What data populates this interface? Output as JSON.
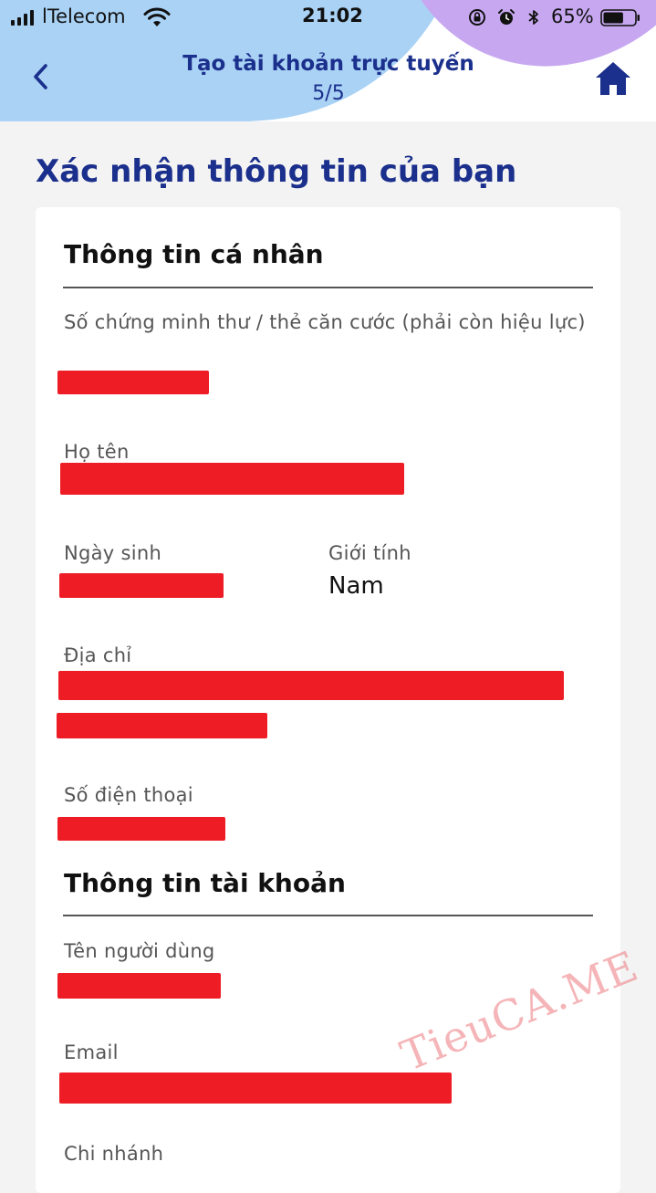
{
  "status_bar": {
    "carrier": "lTelecom",
    "time": "21:02",
    "battery_percent": "65%",
    "battery_level": 0.65
  },
  "header": {
    "title": "Tạo tài khoản trực tuyến",
    "step": "5/5",
    "icons": {
      "back": "chevron-left-icon",
      "home": "home-icon"
    }
  },
  "page": {
    "heading": "Xác nhận thông tin của bạn"
  },
  "personal": {
    "title": "Thông tin cá nhân",
    "id_label": "Số chứng minh thư / thẻ căn cước (phải còn hiệu lực)",
    "name_label": "Họ tên",
    "dob_label": "Ngày sinh",
    "gender_label": "Giới tính",
    "gender_value": "Nam",
    "address_label": "Địa chỉ",
    "phone_label": "Số điện thoại"
  },
  "account": {
    "title": "Thông tin tài khoản",
    "username_label": "Tên người dùng",
    "email_label": "Email",
    "branch_label": "Chi nhánh"
  },
  "watermark": "TieuCA.ME",
  "colors": {
    "brand": "#1b2f8c",
    "redaction": "#ee1c25",
    "header_blue": "#a9d2f5",
    "header_purple": "#c7a8f0"
  }
}
